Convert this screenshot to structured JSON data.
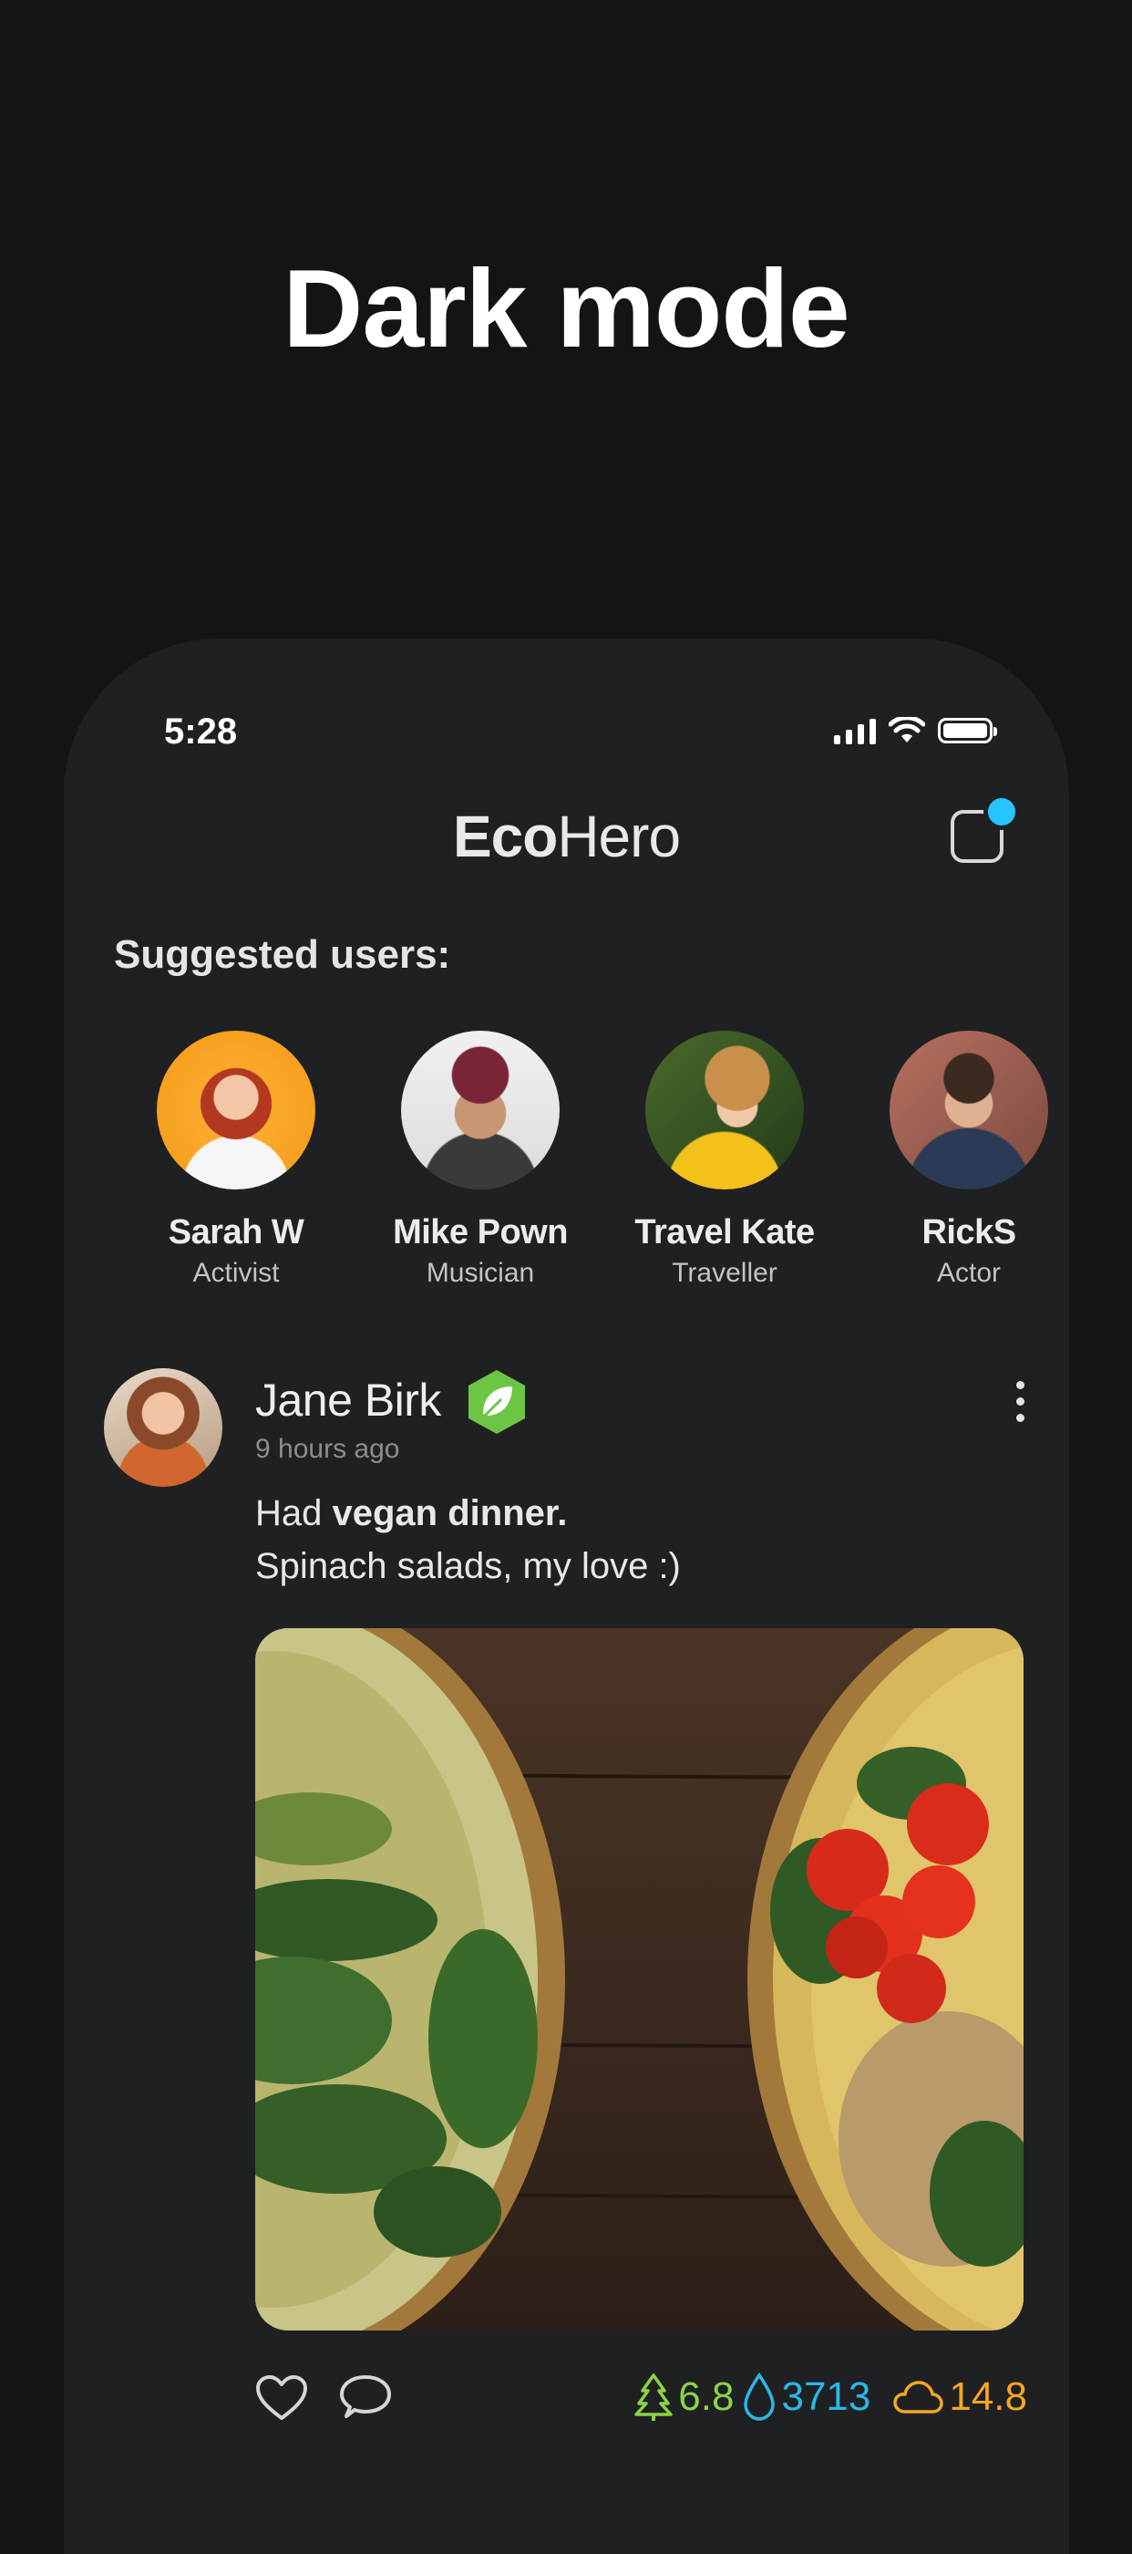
{
  "hero": {
    "title": "Dark mode"
  },
  "status_bar": {
    "time": "5:28"
  },
  "app": {
    "logo_bold": "Eco",
    "logo_regular": "Hero"
  },
  "suggested": {
    "title": "Suggested users:",
    "users": [
      {
        "name": "Sarah W",
        "role": "Activist"
      },
      {
        "name": "Mike Pown",
        "role": "Musician"
      },
      {
        "name": "Travel Kate",
        "role": "Traveller"
      },
      {
        "name": "RickS",
        "role": "Actor"
      }
    ]
  },
  "post": {
    "author": "Jane Birk",
    "time": "9 hours ago",
    "text_prefix": "Had ",
    "text_bold": "vegan dinner.",
    "text_line2": "Spinach salads, my love :)",
    "stats": {
      "trees": "6.8",
      "water": "3713",
      "co2": "14.8"
    }
  },
  "colors": {
    "background": "#141414",
    "card": "#1f2022",
    "accent_blue": "#27c5ff",
    "tree_green": "#8bd346",
    "water_blue": "#2bb7e8",
    "cloud_orange": "#f5a623",
    "badge_green": "#6cc644"
  },
  "icons": [
    "cellular-signal-icon",
    "wifi-icon",
    "battery-icon",
    "notification-icon",
    "verified-leaf-icon",
    "more-vertical-icon",
    "heart-icon",
    "comment-icon",
    "tree-icon",
    "water-drop-icon",
    "cloud-icon"
  ]
}
